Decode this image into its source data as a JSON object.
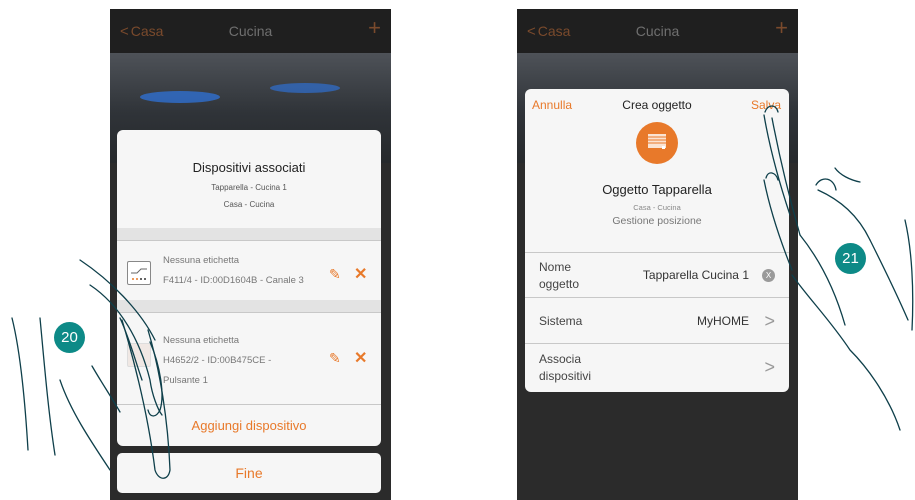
{
  "left_screen": {
    "nav": {
      "back_label": "Casa",
      "title": "Cucina",
      "add_icon": "plus-icon"
    },
    "dialog": {
      "title": "Dispositivi associati",
      "subtitle_object": "Tapparella - Cucina 1",
      "subtitle_location": "Casa - Cucina",
      "devices": [
        {
          "label": "Nessuna etichetta",
          "desc": "F411/4 - ID:00D1604B - Canale 3"
        },
        {
          "label": "Nessuna etichetta",
          "desc_line1": "H4652/2 - ID:00B475CE -",
          "desc_line2": "Pulsante 1"
        }
      ],
      "add_device_label": "Aggiungi dispositivo"
    },
    "done_label": "Fine"
  },
  "right_screen": {
    "nav": {
      "back_label": "Casa",
      "title": "Cucina",
      "add_icon": "plus-icon"
    },
    "dialog": {
      "cancel_label": "Annulla",
      "title": "Crea oggetto",
      "save_label": "Salva",
      "object_icon": "shutter-icon",
      "object_name": "Oggetto Tapparella",
      "object_location": "Casa - Cucina",
      "object_function": "Gestione posizione",
      "rows": [
        {
          "label_line1": "Nome",
          "label_line2": "oggetto",
          "value": "Tapparella Cucina 1"
        },
        {
          "label": "Sistema",
          "value": "MyHOME"
        },
        {
          "label_line1": "Associa",
          "label_line2": "dispositivi"
        }
      ]
    }
  },
  "steps": {
    "left": "20",
    "right": "21"
  },
  "colors": {
    "accent": "#e8792a",
    "step_badge": "#0d8a87",
    "card": "#f6f6f6",
    "background": "#2b2b2b"
  }
}
